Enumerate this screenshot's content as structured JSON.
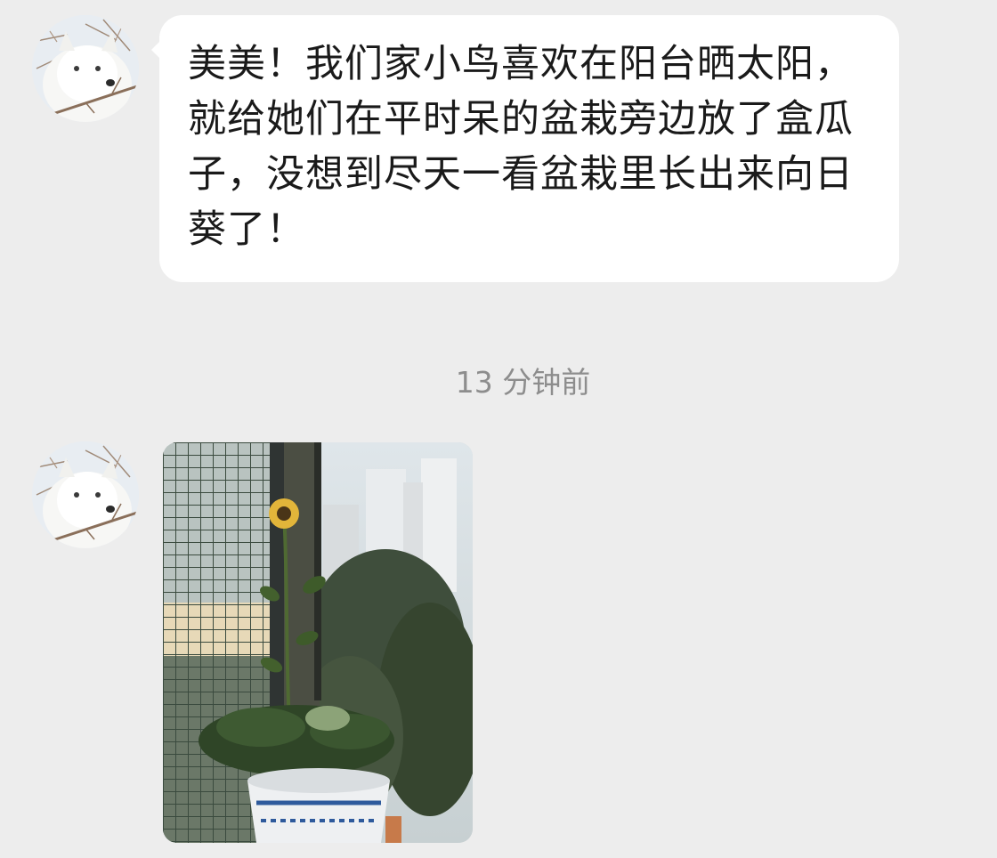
{
  "messages": [
    {
      "sender_avatar": "white-puppy-avatar",
      "type": "text",
      "text": "美美！我们家小鸟喜欢在阳台晒太阳，就给她们在平时呆的盆栽旁边放了盒瓜子，没想到尽天一看盆栽里长出来向日葵了！"
    },
    {
      "sender_avatar": "white-puppy-avatar",
      "type": "image",
      "image_subject": "sunflower-in-flowerpot-on-balcony"
    }
  ],
  "timestamp": "13 分钟前",
  "colors": {
    "background": "#ededed",
    "bubble": "#ffffff",
    "text": "#1a1a1a",
    "timestamp": "#8d8d8d"
  }
}
